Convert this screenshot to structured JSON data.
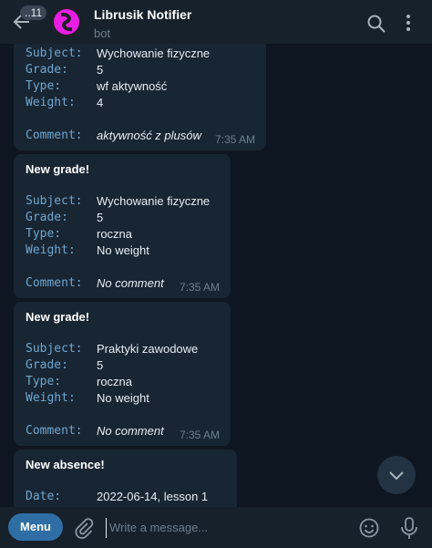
{
  "header": {
    "back_badge": "..11",
    "title": "Librusik Notifier",
    "subtitle": "bot"
  },
  "messages": [
    {
      "fields": [
        {
          "key": "Subject:",
          "value": "Wychowanie fizyczne"
        },
        {
          "key": "Grade:",
          "value": "5"
        },
        {
          "key": "Type:",
          "value": "wf aktywność"
        },
        {
          "key": "Weight:",
          "value": "4"
        }
      ],
      "comment_key": "Comment:",
      "comment": "aktywność z plusów",
      "time": "7:35 AM"
    },
    {
      "heading": "New grade!",
      "fields": [
        {
          "key": "Subject:",
          "value": "Wychowanie fizyczne"
        },
        {
          "key": "Grade:",
          "value": "5"
        },
        {
          "key": "Type:",
          "value": "roczna"
        },
        {
          "key": "Weight:",
          "value": "No weight"
        }
      ],
      "comment_key": "Comment:",
      "comment": "No comment",
      "time": "7:35 AM"
    },
    {
      "heading": "New grade!",
      "fields": [
        {
          "key": "Subject:",
          "value": "Praktyki zawodowe"
        },
        {
          "key": "Grade:",
          "value": "5"
        },
        {
          "key": "Type:",
          "value": "roczna"
        },
        {
          "key": "Weight:",
          "value": "No weight"
        }
      ],
      "comment_key": "Comment:",
      "comment": "No comment",
      "time": "7:35 AM"
    },
    {
      "heading": "New absence!",
      "fields": [
        {
          "key": "Date:",
          "value": "2022-06-14, lesson 1"
        }
      ]
    }
  ],
  "composer": {
    "menu_label": "Menu",
    "placeholder": "Write a message..."
  },
  "colors": {
    "background": "#0e1621",
    "panel": "#17212b",
    "bubble": "#182533",
    "accent": "#2f6ea5",
    "key_text": "#6fa7cf"
  }
}
